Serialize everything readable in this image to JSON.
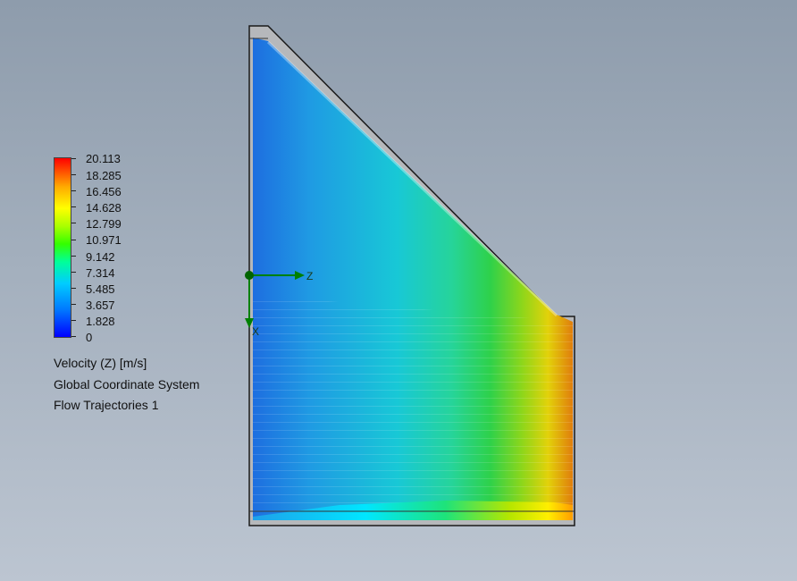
{
  "legend": {
    "values": [
      "20.113",
      "18.285",
      "16.456",
      "14.628",
      "12.799",
      "10.971",
      "9.142",
      "7.314",
      "5.485",
      "3.657",
      "1.828",
      "0"
    ]
  },
  "captions": {
    "quantity": "Velocity (Z) [m/s]",
    "coordinate_system": "Global Coordinate System",
    "plot_name": "Flow Trajectories 1"
  },
  "triad": {
    "z_label": "Z",
    "x_label": "X"
  },
  "colors": {
    "axis_green": "#008000",
    "legend_min": "#0000ff",
    "legend_max": "#ff0000"
  }
}
